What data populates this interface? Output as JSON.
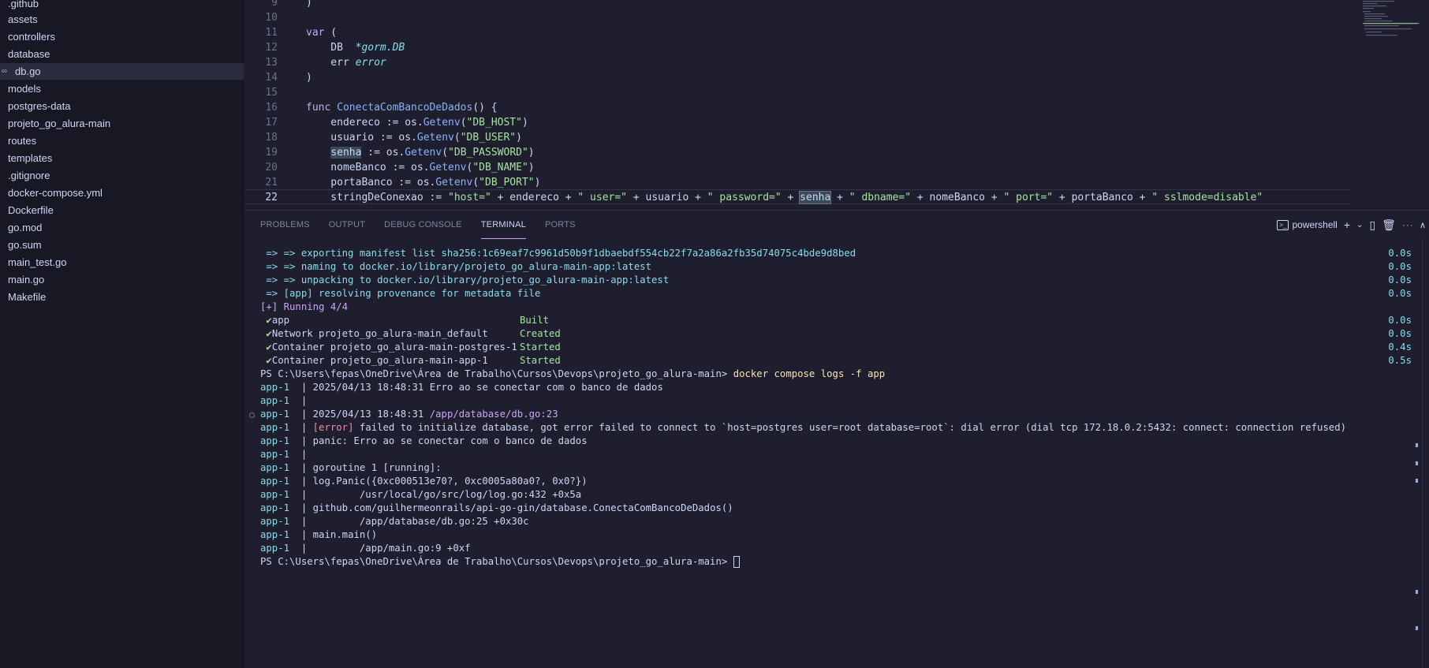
{
  "explorer": {
    "items": [
      {
        "label": ".github",
        "icon": ""
      },
      {
        "label": "assets",
        "icon": ""
      },
      {
        "label": "controllers",
        "icon": ""
      },
      {
        "label": "database",
        "icon": ""
      },
      {
        "label": "db.go",
        "icon": "go-file-icon"
      },
      {
        "label": "models",
        "icon": ""
      },
      {
        "label": "postgres-data",
        "icon": ""
      },
      {
        "label": "projeto_go_alura-main",
        "icon": ""
      },
      {
        "label": "routes",
        "icon": ""
      },
      {
        "label": "templates",
        "icon": ""
      },
      {
        "label": ".gitignore",
        "icon": ""
      },
      {
        "label": "docker-compose.yml",
        "icon": ""
      },
      {
        "label": "Dockerfile",
        "icon": ""
      },
      {
        "label": "go.mod",
        "icon": ""
      },
      {
        "label": "go.sum",
        "icon": ""
      },
      {
        "label": "main_test.go",
        "icon": ""
      },
      {
        "label": "main.go",
        "icon": ""
      },
      {
        "label": "Makefile",
        "icon": ""
      }
    ]
  },
  "editor": {
    "line_numbers": [
      "9",
      "10",
      "11",
      "12",
      "13",
      "14",
      "15",
      "16",
      "17",
      "18",
      "19",
      "20",
      "21",
      "22"
    ],
    "current_line": "22",
    "code": {
      "l9": ")",
      "l11_kw": "var",
      "l11_rest": " (",
      "l12_a": "    DB  ",
      "l12_b": "*gorm.DB",
      "l13_a": "    err ",
      "l13_b": "error",
      "l14": ")",
      "l16_kw": "func",
      "l16_fn": "ConectaComBancoDeDados",
      "l16_rest": "() {",
      "l17_a": "    endereco := os.",
      "l17_fn": "Getenv",
      "l17_str": "\"DB_HOST\"",
      "l18_a": "    usuario := os.",
      "l18_str": "\"DB_USER\"",
      "l19_hl": "senha",
      "l19_a": " := os.",
      "l19_str": "\"DB_PASSWORD\"",
      "l20_a": "    nomeBanco := os.",
      "l20_str": "\"DB_NAME\"",
      "l21_a": "    portaBanco := os.",
      "l21_str": "\"DB_PORT\"",
      "l22_a": "    stringDeConexao := ",
      "l22_s1": "\"host=\"",
      "l22_v1": " + endereco + ",
      "l22_s2": "\" user=\"",
      "l22_v2": " + usuario + ",
      "l22_s3": "\" password=\"",
      "l22_v3a": " + ",
      "l22_hl": "senha",
      "l22_v3b": " + ",
      "l22_s4": "\" dbname=\"",
      "l22_v4": " + nomeBanco + ",
      "l22_s5": "\" port=\"",
      "l22_v5": " + portaBanco + ",
      "l22_s6": "\" sslmode=disable\""
    }
  },
  "panel": {
    "tabs": [
      "PROBLEMS",
      "OUTPUT",
      "DEBUG CONSOLE",
      "TERMINAL",
      "PORTS"
    ],
    "active_tab": "TERMINAL",
    "shell_label": "powershell"
  },
  "terminal": {
    "build_lines": [
      {
        "text": " => => exporting manifest list sha256:1c69eaf7c9961d50b9f1dbaebdf554cb22f7a2a86a2fb35d74075c4bde9d8bed",
        "time": "0.0s"
      },
      {
        "text": " => => naming to docker.io/library/projeto_go_alura-main-app:latest",
        "time": "0.0s"
      },
      {
        "text": " => => unpacking to docker.io/library/projeto_go_alura-main-app:latest",
        "time": "0.0s"
      },
      {
        "text": " => [app] resolving provenance for metadata file",
        "time": "0.0s"
      }
    ],
    "running": "[+] Running 4/4",
    "services": [
      {
        "name": "app",
        "status": "Built",
        "time": "0.0s"
      },
      {
        "name": "Network projeto_go_alura-main_default",
        "status": "Created",
        "time": "0.0s"
      },
      {
        "name": "Container projeto_go_alura-main-postgres-1",
        "status": "Started",
        "time": "0.4s"
      },
      {
        "name": "Container projeto_go_alura-main-app-1",
        "status": "Started",
        "time": "0.5s"
      }
    ],
    "prompt": "PS C:\\Users\\fepas\\OneDrive\\Área de Trabalho\\Cursos\\Devops\\projeto_go_alura-main>",
    "command": "docker compose logs -f app",
    "log_prefix": "app-1",
    "logs": [
      {
        "text": "2025/04/13 18:48:31 Erro ao se conectar com o banco de dados"
      },
      {
        "text": ""
      },
      {
        "text": "2025/04/13 18:48:31 ",
        "path": "/app/database/db.go:23"
      },
      {
        "tag": "[error]",
        "text": " failed to initialize database, got error failed to connect to `host=postgres user=root database=root`: dial error (dial tcp 172.18.0.2:5432: connect: connection refused)"
      },
      {
        "text": "panic: Erro ao se conectar com o banco de dados"
      },
      {
        "text": ""
      },
      {
        "text": "goroutine 1 [running]:"
      },
      {
        "text": "log.Panic({0xc000513e70?, 0xc0005a80a0?, 0x0?})"
      },
      {
        "text": "        /usr/local/go/src/log/log.go:432 +0x5a"
      },
      {
        "text": "github.com/guilhermeonrails/api-go-gin/database.ConectaComBancoDeDados()"
      },
      {
        "text": "        /app/database/db.go:25 +0x30c"
      },
      {
        "text": "main.main()"
      },
      {
        "text": "        /app/main.go:9 +0xf"
      }
    ]
  }
}
